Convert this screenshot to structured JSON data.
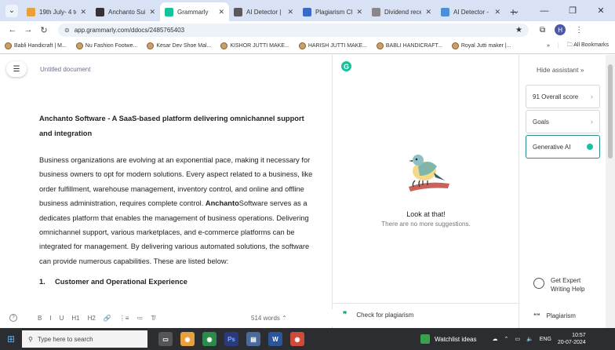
{
  "browser": {
    "tabs": [
      {
        "title": "19th July- 4 topi",
        "fav_color": "#e8a03c",
        "active": false
      },
      {
        "title": "Anchanto Suite",
        "fav_color": "#333333",
        "active": false
      },
      {
        "title": "Grammarly",
        "fav_color": "#15c39a",
        "active": true
      },
      {
        "title": "AI Detector | Ch",
        "fav_color": "#5a5a5a",
        "active": false
      },
      {
        "title": "Plagiarism Chec",
        "fav_color": "#3a6ac8",
        "active": false
      },
      {
        "title": "Dividend receiv",
        "fav_color": "#888888",
        "active": false
      },
      {
        "title": "AI Detector - Tr",
        "fav_color": "#4a90d9",
        "active": false
      }
    ],
    "new_tab": "+",
    "url": "app.grammarly.com/ddocs/2485765403",
    "profile_initial": "H",
    "bookmarks": [
      "Babli Handicraft | M...",
      "Nu Fashion Footwe...",
      "Kesar Dev Shoe Mal...",
      "KISHOR JUTTI MAKE...",
      "HARISH JUTTI MAKE...",
      "BABLI HANDICRAFT...",
      "Royal Jutti maker |..."
    ],
    "bookmarks_more": "»",
    "all_bookmarks": "All Bookmarks"
  },
  "editor": {
    "doc_title": "Untitled document",
    "heading": "Anchanto Software - A SaaS-based platform delivering omnichannel support and integration",
    "para_before_bold": "Business organizations are evolving at an exponential pace, making it necessary for business owners to opt for modern solutions. Every aspect related to a business, like order fulfillment, warehouse management, inventory control, and online and offline business administration, requires complete control. ",
    "para_bold": "Anchanto",
    "para_after_bold": "Software serves as a dedicates platform that enables the management of business operations. Delivering omnichannel support, various marketplaces, and e-commerce platforms can be integrated for management. By delivering various automated solutions, the software can provide numerous capabilities. These are listed below:",
    "list_num": "1.",
    "list_item": "Customer and Operational Experience",
    "word_count": "514 words",
    "format_tools": [
      "B",
      "I",
      "U",
      "H1",
      "H2",
      "🔗",
      "⋮≡",
      "≔",
      "T̸"
    ]
  },
  "assistant": {
    "look_title": "Look at that!",
    "look_sub": "There are no more suggestions.",
    "check_plagiarism": "Check for plagiarism"
  },
  "sidebar": {
    "hide": "Hide assistant",
    "score": "91 Overall score",
    "goals": "Goals",
    "genai": "Generative AI",
    "expert": "Get Expert Writing Help",
    "plagiarism": "Plagiarism"
  },
  "taskbar": {
    "search": "Type here to search",
    "watchlist": "Watchlist ideas",
    "lang": "ENG",
    "time": "10:57",
    "date": "20-07-2024"
  }
}
